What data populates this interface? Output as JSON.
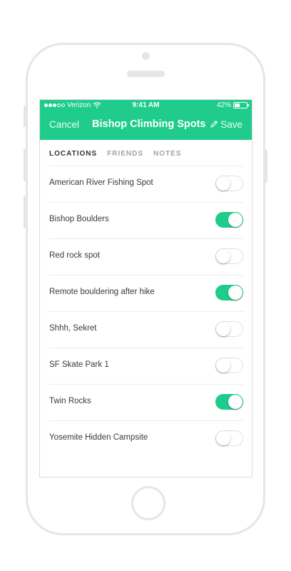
{
  "status_bar": {
    "carrier": "Verizon",
    "time": "9:41 AM",
    "battery": "42%",
    "battery_level": 0.42
  },
  "nav": {
    "cancel_label": "Cancel",
    "title": "Bishop Climbing Spots",
    "save_label": "Save"
  },
  "tabs": [
    {
      "label": "LOCATIONS",
      "active": true
    },
    {
      "label": "FRIENDS",
      "active": false
    },
    {
      "label": "NOTES",
      "active": false
    }
  ],
  "locations": [
    {
      "name": "American River Fishing Spot",
      "enabled": false
    },
    {
      "name": "Bishop Boulders",
      "enabled": true
    },
    {
      "name": "Red rock spot",
      "enabled": false
    },
    {
      "name": "Remote bouldering after hike",
      "enabled": true
    },
    {
      "name": "Shhh, Sekret",
      "enabled": false
    },
    {
      "name": "SF Skate Park 1",
      "enabled": false
    },
    {
      "name": "Twin Rocks",
      "enabled": true
    },
    {
      "name": "Yosemite Hidden Campsite",
      "enabled": false
    }
  ],
  "colors": {
    "accent": "#1fcc8c",
    "frame": "#e6e6e6"
  }
}
